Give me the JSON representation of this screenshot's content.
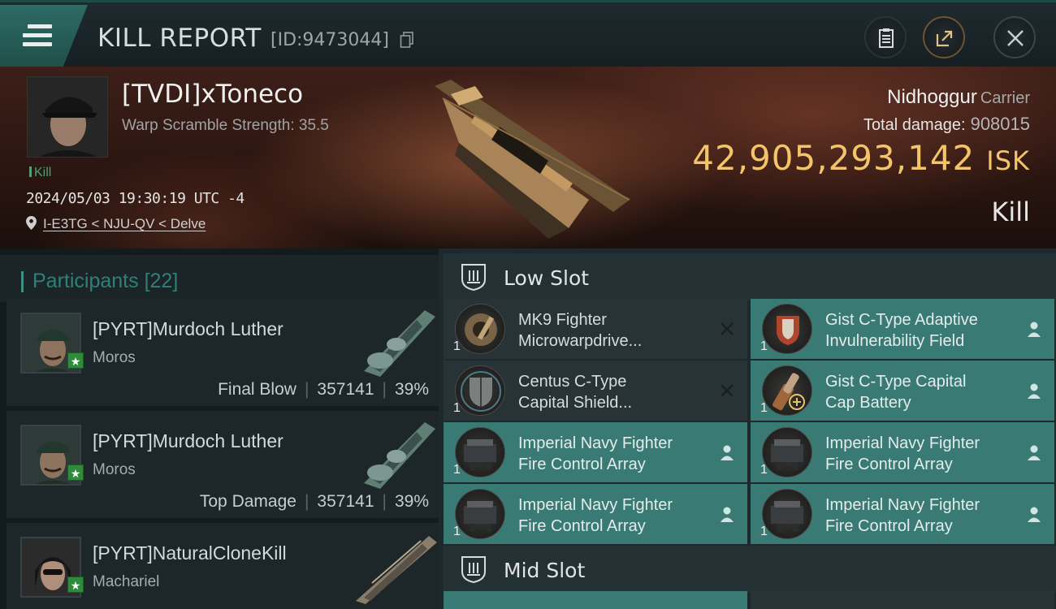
{
  "header": {
    "title": "KILL REPORT",
    "id_label": "[ID:9473044]"
  },
  "victim": {
    "name": "[TVDI]xToneco",
    "scramble": "Warp Scramble Strength: 35.5",
    "tag": "Kill",
    "datetime": "2024/05/03 19:30:19 UTC -4",
    "location": "I-E3TG < NJU-QV < Delve",
    "ship": "Nidhoggur",
    "ship_class": "Carrier",
    "total_damage_label": "Total damage:",
    "total_damage": "908015",
    "isk_value": "42,905,293,142",
    "isk_unit": "ISK",
    "result": "Kill"
  },
  "participants": {
    "title": "Participants",
    "count": "[22]",
    "rows": [
      {
        "name": "[PYRT]Murdoch Luther",
        "ship": "Moros",
        "role": "Final Blow",
        "damage": "357141",
        "percent": "39%"
      },
      {
        "name": "[PYRT]Murdoch Luther",
        "ship": "Moros",
        "role": "Top Damage",
        "damage": "357141",
        "percent": "39%"
      },
      {
        "name": "[PYRT]NaturalCloneKill",
        "ship": "Machariel",
        "role": "",
        "damage": "",
        "percent": ""
      }
    ]
  },
  "fittings": {
    "low_slot_title": "Low Slot",
    "mid_slot_title": "Mid Slot",
    "low_slot": [
      {
        "name": "MK9 Fighter\nMicrowarpdrive...",
        "qty": "1",
        "status": "destroyed",
        "icon": "microwarpdrive-icon"
      },
      {
        "name": "Gist C-Type Adaptive\nInvulnerability Field",
        "qty": "1",
        "status": "dropped",
        "icon": "invulnerability-field-icon"
      },
      {
        "name": "Centus C-Type\nCapital Shield...",
        "qty": "1",
        "status": "destroyed",
        "icon": "shield-booster-icon"
      },
      {
        "name": "Gist C-Type Capital\nCap Battery",
        "qty": "1",
        "status": "dropped",
        "icon": "cap-battery-icon"
      },
      {
        "name": "Imperial Navy Fighter\nFire Control Array",
        "qty": "1",
        "status": "dropped",
        "icon": "fire-control-icon"
      },
      {
        "name": "Imperial Navy Fighter\nFire Control Array",
        "qty": "1",
        "status": "dropped",
        "icon": "fire-control-icon"
      },
      {
        "name": "Imperial Navy Fighter\nFire Control Array",
        "qty": "1",
        "status": "dropped",
        "icon": "fire-control-icon"
      },
      {
        "name": "Imperial Navy Fighter\nFire Control Array",
        "qty": "1",
        "status": "dropped",
        "icon": "fire-control-icon"
      }
    ]
  },
  "colors": {
    "accent_teal": "#3a7a75",
    "isk_gold": "#f4c46a",
    "kill_green": "#4fa074"
  }
}
